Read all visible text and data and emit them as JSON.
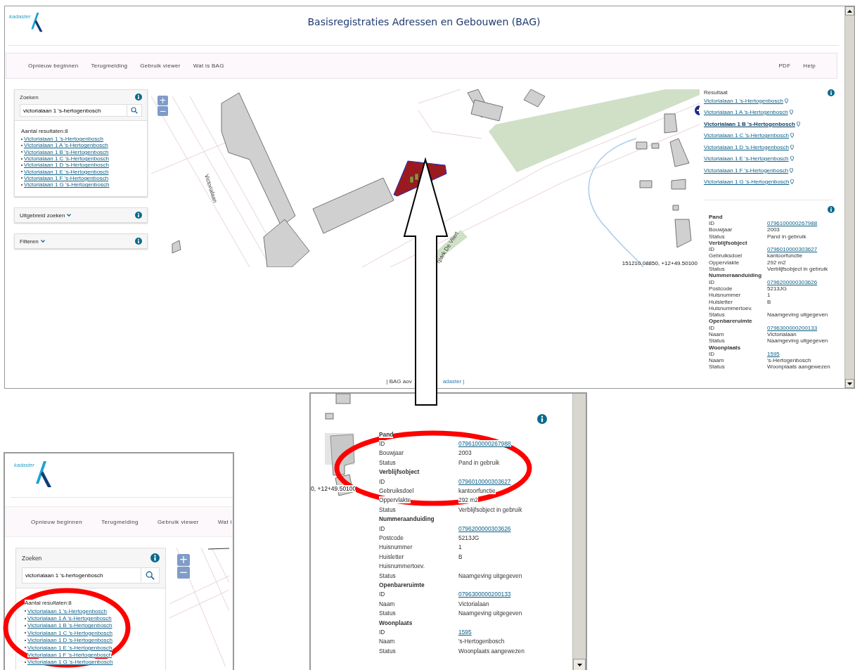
{
  "main_screenshot": {
    "logo_text": "kadaster",
    "title": "Basisregistraties Adressen en Gebouwen (BAG)",
    "nav_left": [
      "Opnieuw beginnen",
      "Terugmelding",
      "Gebruik viewer",
      "Wat is BAG"
    ],
    "nav_right": [
      "PDF",
      "Help"
    ],
    "search_panel": {
      "title": "Zoeken",
      "value": "victorialaan 1 's-hertogenbosch",
      "result_count": "Aantal resultaten:8",
      "results": [
        "Victorialaan 1 's-Hertogenbosch",
        "Victorialaan 1 A 's-Hertogenbosch",
        "Victorialaan 1 B 's-Hertogenbosch",
        "Victorialaan 1 C 's-Hertogenbosch",
        "Victorialaan 1 D 's-Hertogenbosch",
        "Victorialaan 1 E 's-Hertogenbosch",
        "Victorialaan 1 F 's-Hertogenbosch",
        "Victorialaan 1 G 's-Hertogenbosch"
      ]
    },
    "collapsed_panels": [
      "Uitgebreid zoeken",
      "Filteren"
    ],
    "map": {
      "zoom_in": "+",
      "zoom_out": "−",
      "street_labels": [
        "Victorialaan",
        "rpark De Vliert"
      ],
      "coordinates": "151210.08850, +12+49.50100"
    },
    "footer": [
      "| BAG aov",
      "adaster |"
    ],
    "result_panel": {
      "title": "Resultaat",
      "items": [
        {
          "label": "Victorialaan 1 's-Hertogenbosch",
          "selected": false
        },
        {
          "label": "Victorialaan 1 A 's-Hertogenbosch",
          "selected": false
        },
        {
          "label": "Victorialaan 1 B 's-Hertogenbosch",
          "selected": true
        },
        {
          "label": "Victorialaan 1 C 's-Hertogenbosch",
          "selected": false
        },
        {
          "label": "Victorialaan 1 D 's-Hertogenbosch",
          "selected": false
        },
        {
          "label": "Victorialaan 1 E 's-Hertogenbosch",
          "selected": false
        },
        {
          "label": "Victorialaan 1 F 's-Hertogenbosch",
          "selected": false
        },
        {
          "label": "Victorialaan 1 G 's-Hertogenbosch",
          "selected": false
        }
      ]
    },
    "details": [
      {
        "kind": "heading",
        "label": "Pand"
      },
      {
        "kind": "link",
        "label": "ID",
        "value": "0796100000267988"
      },
      {
        "kind": "text",
        "label": "Bouwjaar",
        "value": "2003"
      },
      {
        "kind": "text",
        "label": "Status",
        "value": "Pand in gebruik"
      },
      {
        "kind": "heading",
        "label": "Verblijfsobject"
      },
      {
        "kind": "link",
        "label": "ID",
        "value": "0796010000303627"
      },
      {
        "kind": "text",
        "label": "Gebruiksdoel",
        "value": "kantoorfunctie"
      },
      {
        "kind": "text",
        "label": "Oppervlakte",
        "value": "292 m2"
      },
      {
        "kind": "text",
        "label": "Status",
        "value": "Verblijfsobject in gebruik"
      },
      {
        "kind": "heading",
        "label": "Nummeraanduiding"
      },
      {
        "kind": "link",
        "label": "ID",
        "value": "0796200000303626"
      },
      {
        "kind": "text",
        "label": "Postcode",
        "value": "5213JG"
      },
      {
        "kind": "text",
        "label": "Huisnummer",
        "value": "1"
      },
      {
        "kind": "text",
        "label": "Huisletter",
        "value": "B"
      },
      {
        "kind": "text",
        "label": "Huisnummertoev."
      },
      {
        "kind": "text",
        "label": "Status",
        "value": "Naamgeving uitgegeven"
      },
      {
        "kind": "heading",
        "label": "Openbareruimte"
      },
      {
        "kind": "link",
        "label": "ID",
        "value": "0796300000200133"
      },
      {
        "kind": "text",
        "label": "Naam",
        "value": "Victorialaan"
      },
      {
        "kind": "text",
        "label": "Status",
        "value": "Naamgeving uitgegeven"
      },
      {
        "kind": "heading",
        "label": "Woonplaats"
      },
      {
        "kind": "link",
        "label": "ID",
        "value": "1595"
      },
      {
        "kind": "text",
        "label": "Naam",
        "value": "'s-Hertogenbosch"
      },
      {
        "kind": "text",
        "label": "Status",
        "value": "Woonplaats aangewezen"
      }
    ]
  },
  "details_zoom": {
    "coordinates": "0, +12+49.50100",
    "details": [
      {
        "kind": "heading",
        "label": "Pand"
      },
      {
        "kind": "link",
        "label": "ID",
        "value": "0796100000267988"
      },
      {
        "kind": "text",
        "label": "Bouwjaar",
        "value": "2003"
      },
      {
        "kind": "text",
        "label": "Status",
        "value": "Pand in gebruik"
      },
      {
        "kind": "heading",
        "label": "Verblijfsobject"
      },
      {
        "kind": "link",
        "label": "ID",
        "value": "0796010000303627"
      },
      {
        "kind": "text",
        "label": "Gebruiksdoel",
        "value": "kantoorfunctie"
      },
      {
        "kind": "text",
        "label": "Oppervlakte",
        "value": "292 m2"
      },
      {
        "kind": "text",
        "label": "Status",
        "value": "Verblijfsobject in gebruik"
      },
      {
        "kind": "heading",
        "label": "Nummeraanduiding"
      },
      {
        "kind": "link",
        "label": "ID",
        "value": "0796200000303626"
      },
      {
        "kind": "text",
        "label": "Postcode",
        "value": "5213JG"
      },
      {
        "kind": "text",
        "label": "Huisnummer",
        "value": "1"
      },
      {
        "kind": "text",
        "label": "Huisletter",
        "value": "B"
      },
      {
        "kind": "text",
        "label": "Huisnummertoev."
      },
      {
        "kind": "text",
        "label": "Status",
        "value": "Naamgeving uitgegeven"
      },
      {
        "kind": "heading",
        "label": "Openbareruimte"
      },
      {
        "kind": "link",
        "label": "ID",
        "value": "0796300000200133"
      },
      {
        "kind": "text",
        "label": "Naam",
        "value": "Victorialaan"
      },
      {
        "kind": "text",
        "label": "Status",
        "value": "Naamgeving uitgegeven"
      },
      {
        "kind": "heading",
        "label": "Woonplaats"
      },
      {
        "kind": "link",
        "label": "ID",
        "value": "1595"
      },
      {
        "kind": "text",
        "label": "Naam",
        "value": "'s-Hertogenbosch"
      },
      {
        "kind": "text",
        "label": "Status",
        "value": "Woonplaats aangewezen"
      }
    ]
  },
  "search_zoom": {
    "logo_text": "kadaster",
    "nav": [
      "Opnieuw beginnen",
      "Terugmelding",
      "Gebruik viewer",
      "Wat i"
    ],
    "title": "Zoeken",
    "value": "victorialaan 1 's-hertogenbosch",
    "zoom_in": "+",
    "zoom_out": "−",
    "result_count": "Aantal resultaten:8",
    "results": [
      "Victorialaan 1 's-Hertogenbosch",
      "Victorialaan 1 A 's-Hertogenbosch",
      "Victorialaan 1 B 's-Hertogenbosch",
      "Victorialaan 1 C 's-Hertogenbosch",
      "Victorialaan 1 D 's-Hertogenbosch",
      "Victorialaan 1 E 's-Hertogenbosch",
      "Victorialaan 1 F 's-Hertogenbosch",
      "Victorialaan 1 G 's-Hertogenbosch"
    ]
  }
}
